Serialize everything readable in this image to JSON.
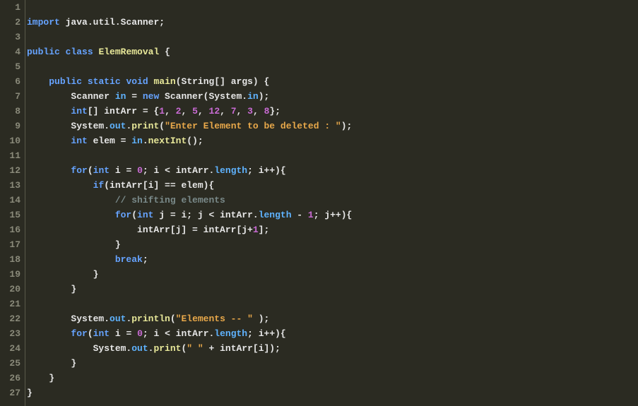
{
  "lines": [
    {
      "num": "1",
      "tokens": []
    },
    {
      "num": "2",
      "tokens": [
        {
          "class": "kw",
          "text": "import"
        },
        {
          "class": "punct",
          "text": " java"
        },
        {
          "class": "punct",
          "text": "."
        },
        {
          "class": "punct",
          "text": "util"
        },
        {
          "class": "punct",
          "text": "."
        },
        {
          "class": "punct",
          "text": "Scanner"
        },
        {
          "class": "punct",
          "text": ";"
        }
      ]
    },
    {
      "num": "3",
      "tokens": []
    },
    {
      "num": "4",
      "tokens": [
        {
          "class": "kw",
          "text": "public"
        },
        {
          "class": "punct",
          "text": " "
        },
        {
          "class": "kw",
          "text": "class"
        },
        {
          "class": "punct",
          "text": " "
        },
        {
          "class": "cls",
          "text": "ElemRemoval"
        },
        {
          "class": "punct",
          "text": " {"
        }
      ]
    },
    {
      "num": "5",
      "tokens": []
    },
    {
      "num": "6",
      "tokens": [
        {
          "class": "punct",
          "text": "    "
        },
        {
          "class": "kw",
          "text": "public"
        },
        {
          "class": "punct",
          "text": " "
        },
        {
          "class": "kw",
          "text": "static"
        },
        {
          "class": "punct",
          "text": " "
        },
        {
          "class": "kw",
          "text": "void"
        },
        {
          "class": "punct",
          "text": " "
        },
        {
          "class": "meth",
          "text": "main"
        },
        {
          "class": "punct",
          "text": "(String[] args) {"
        }
      ]
    },
    {
      "num": "7",
      "tokens": [
        {
          "class": "punct",
          "text": "        Scanner "
        },
        {
          "class": "id-in",
          "text": "in"
        },
        {
          "class": "punct",
          "text": " = "
        },
        {
          "class": "kw-new",
          "text": "new"
        },
        {
          "class": "punct",
          "text": " Scanner(System."
        },
        {
          "class": "id-in",
          "text": "in"
        },
        {
          "class": "punct",
          "text": ");"
        }
      ]
    },
    {
      "num": "8",
      "tokens": [
        {
          "class": "punct",
          "text": "        "
        },
        {
          "class": "kw",
          "text": "int"
        },
        {
          "class": "punct",
          "text": "[] intArr = {"
        },
        {
          "class": "num",
          "text": "1"
        },
        {
          "class": "punct",
          "text": ", "
        },
        {
          "class": "num",
          "text": "2"
        },
        {
          "class": "punct",
          "text": ", "
        },
        {
          "class": "num",
          "text": "5"
        },
        {
          "class": "punct",
          "text": ", "
        },
        {
          "class": "num",
          "text": "12"
        },
        {
          "class": "punct",
          "text": ", "
        },
        {
          "class": "num",
          "text": "7"
        },
        {
          "class": "punct",
          "text": ", "
        },
        {
          "class": "num",
          "text": "3"
        },
        {
          "class": "punct",
          "text": ", "
        },
        {
          "class": "num",
          "text": "8"
        },
        {
          "class": "punct",
          "text": "};"
        }
      ]
    },
    {
      "num": "9",
      "tokens": [
        {
          "class": "punct",
          "text": "        System."
        },
        {
          "class": "id-in",
          "text": "out"
        },
        {
          "class": "punct",
          "text": "."
        },
        {
          "class": "meth",
          "text": "print"
        },
        {
          "class": "punct",
          "text": "("
        },
        {
          "class": "str",
          "text": "\"Enter Element to be deleted : \""
        },
        {
          "class": "punct",
          "text": ");"
        }
      ]
    },
    {
      "num": "10",
      "tokens": [
        {
          "class": "punct",
          "text": "        "
        },
        {
          "class": "kw",
          "text": "int"
        },
        {
          "class": "punct",
          "text": " elem = "
        },
        {
          "class": "id-in",
          "text": "in"
        },
        {
          "class": "punct",
          "text": "."
        },
        {
          "class": "meth",
          "text": "nextInt"
        },
        {
          "class": "punct",
          "text": "();"
        }
      ]
    },
    {
      "num": "11",
      "tokens": []
    },
    {
      "num": "12",
      "tokens": [
        {
          "class": "punct",
          "text": "        "
        },
        {
          "class": "kw-ctrl",
          "text": "for"
        },
        {
          "class": "punct",
          "text": "("
        },
        {
          "class": "kw",
          "text": "int"
        },
        {
          "class": "punct",
          "text": " i = "
        },
        {
          "class": "num",
          "text": "0"
        },
        {
          "class": "punct",
          "text": "; i < intArr."
        },
        {
          "class": "id-in",
          "text": "length"
        },
        {
          "class": "punct",
          "text": "; i++){"
        }
      ]
    },
    {
      "num": "13",
      "tokens": [
        {
          "class": "punct",
          "text": "            "
        },
        {
          "class": "kw-ctrl",
          "text": "if"
        },
        {
          "class": "punct",
          "text": "(intArr[i] == elem){"
        }
      ]
    },
    {
      "num": "14",
      "tokens": [
        {
          "class": "punct",
          "text": "                "
        },
        {
          "class": "cmt",
          "text": "// shifting elements"
        }
      ]
    },
    {
      "num": "15",
      "tokens": [
        {
          "class": "punct",
          "text": "                "
        },
        {
          "class": "kw-ctrl",
          "text": "for"
        },
        {
          "class": "punct",
          "text": "("
        },
        {
          "class": "kw",
          "text": "int"
        },
        {
          "class": "punct",
          "text": " j = i; j < intArr."
        },
        {
          "class": "id-in",
          "text": "length"
        },
        {
          "class": "punct",
          "text": " - "
        },
        {
          "class": "num",
          "text": "1"
        },
        {
          "class": "punct",
          "text": "; j++){"
        }
      ]
    },
    {
      "num": "16",
      "tokens": [
        {
          "class": "punct",
          "text": "                    intArr[j] = intArr[j+"
        },
        {
          "class": "num",
          "text": "1"
        },
        {
          "class": "punct",
          "text": "];"
        }
      ]
    },
    {
      "num": "17",
      "tokens": [
        {
          "class": "punct",
          "text": "                }"
        }
      ]
    },
    {
      "num": "18",
      "tokens": [
        {
          "class": "punct",
          "text": "                "
        },
        {
          "class": "kw-break",
          "text": "break"
        },
        {
          "class": "punct",
          "text": ";"
        }
      ]
    },
    {
      "num": "19",
      "tokens": [
        {
          "class": "punct",
          "text": "            }"
        }
      ]
    },
    {
      "num": "20",
      "tokens": [
        {
          "class": "punct",
          "text": "        }"
        }
      ]
    },
    {
      "num": "21",
      "tokens": []
    },
    {
      "num": "22",
      "tokens": [
        {
          "class": "punct",
          "text": "        System."
        },
        {
          "class": "id-in",
          "text": "out"
        },
        {
          "class": "punct",
          "text": "."
        },
        {
          "class": "meth",
          "text": "println"
        },
        {
          "class": "punct",
          "text": "("
        },
        {
          "class": "str",
          "text": "\"Elements -- \""
        },
        {
          "class": "punct",
          "text": " );"
        }
      ]
    },
    {
      "num": "23",
      "tokens": [
        {
          "class": "punct",
          "text": "        "
        },
        {
          "class": "kw-ctrl",
          "text": "for"
        },
        {
          "class": "punct",
          "text": "("
        },
        {
          "class": "kw",
          "text": "int"
        },
        {
          "class": "punct",
          "text": " i = "
        },
        {
          "class": "num",
          "text": "0"
        },
        {
          "class": "punct",
          "text": "; i < intArr."
        },
        {
          "class": "id-in",
          "text": "length"
        },
        {
          "class": "punct",
          "text": "; i++){"
        }
      ]
    },
    {
      "num": "24",
      "tokens": [
        {
          "class": "punct",
          "text": "            System."
        },
        {
          "class": "id-in",
          "text": "out"
        },
        {
          "class": "punct",
          "text": "."
        },
        {
          "class": "meth",
          "text": "print"
        },
        {
          "class": "punct",
          "text": "("
        },
        {
          "class": "str",
          "text": "\" \""
        },
        {
          "class": "punct",
          "text": " + intArr[i]);"
        }
      ]
    },
    {
      "num": "25",
      "tokens": [
        {
          "class": "punct",
          "text": "        }"
        }
      ]
    },
    {
      "num": "26",
      "tokens": [
        {
          "class": "punct",
          "text": "    }"
        }
      ]
    },
    {
      "num": "27",
      "tokens": [
        {
          "class": "punct",
          "text": "}"
        }
      ]
    }
  ]
}
